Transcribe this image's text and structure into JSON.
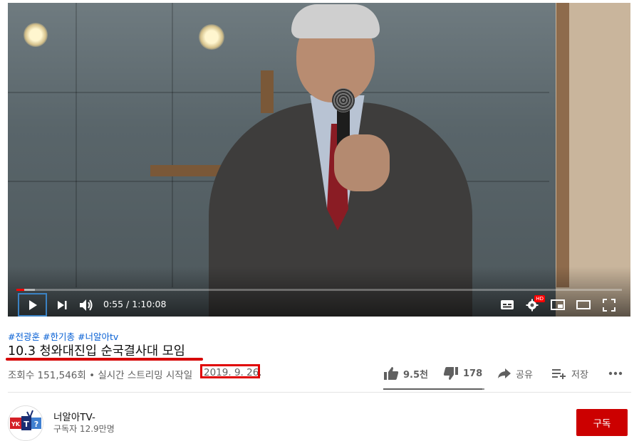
{
  "player": {
    "time_current": "0:55",
    "time_separator": " / ",
    "time_total": "1:10:08",
    "progress_fraction": 0.013,
    "buffer_fraction": 0.03,
    "hd_badge": "HD"
  },
  "video": {
    "hashtags": [
      "#전광훈",
      "#한기총",
      "#너알아tv"
    ],
    "title": "10.3 청와대진입 순국결사대 모임",
    "views_and_type": "조회수 151,546회 • 실시간 스트리밍 시작일",
    "date": "2019. 9. 26."
  },
  "actions": {
    "like_count": "9.5천",
    "dislike_count": "178",
    "share_label": "공유",
    "save_label": "저장",
    "like_fraction": 0.98
  },
  "channel": {
    "name": "너알아TV-",
    "subscribers": "구독자 12.9만명",
    "subscribe_label": "구독",
    "avatar_letters": [
      "YK",
      "T",
      "?"
    ]
  },
  "colors": {
    "accent_red": "#cc0000",
    "hashtag_blue": "#065fd4",
    "progress_red": "#ff0000"
  }
}
